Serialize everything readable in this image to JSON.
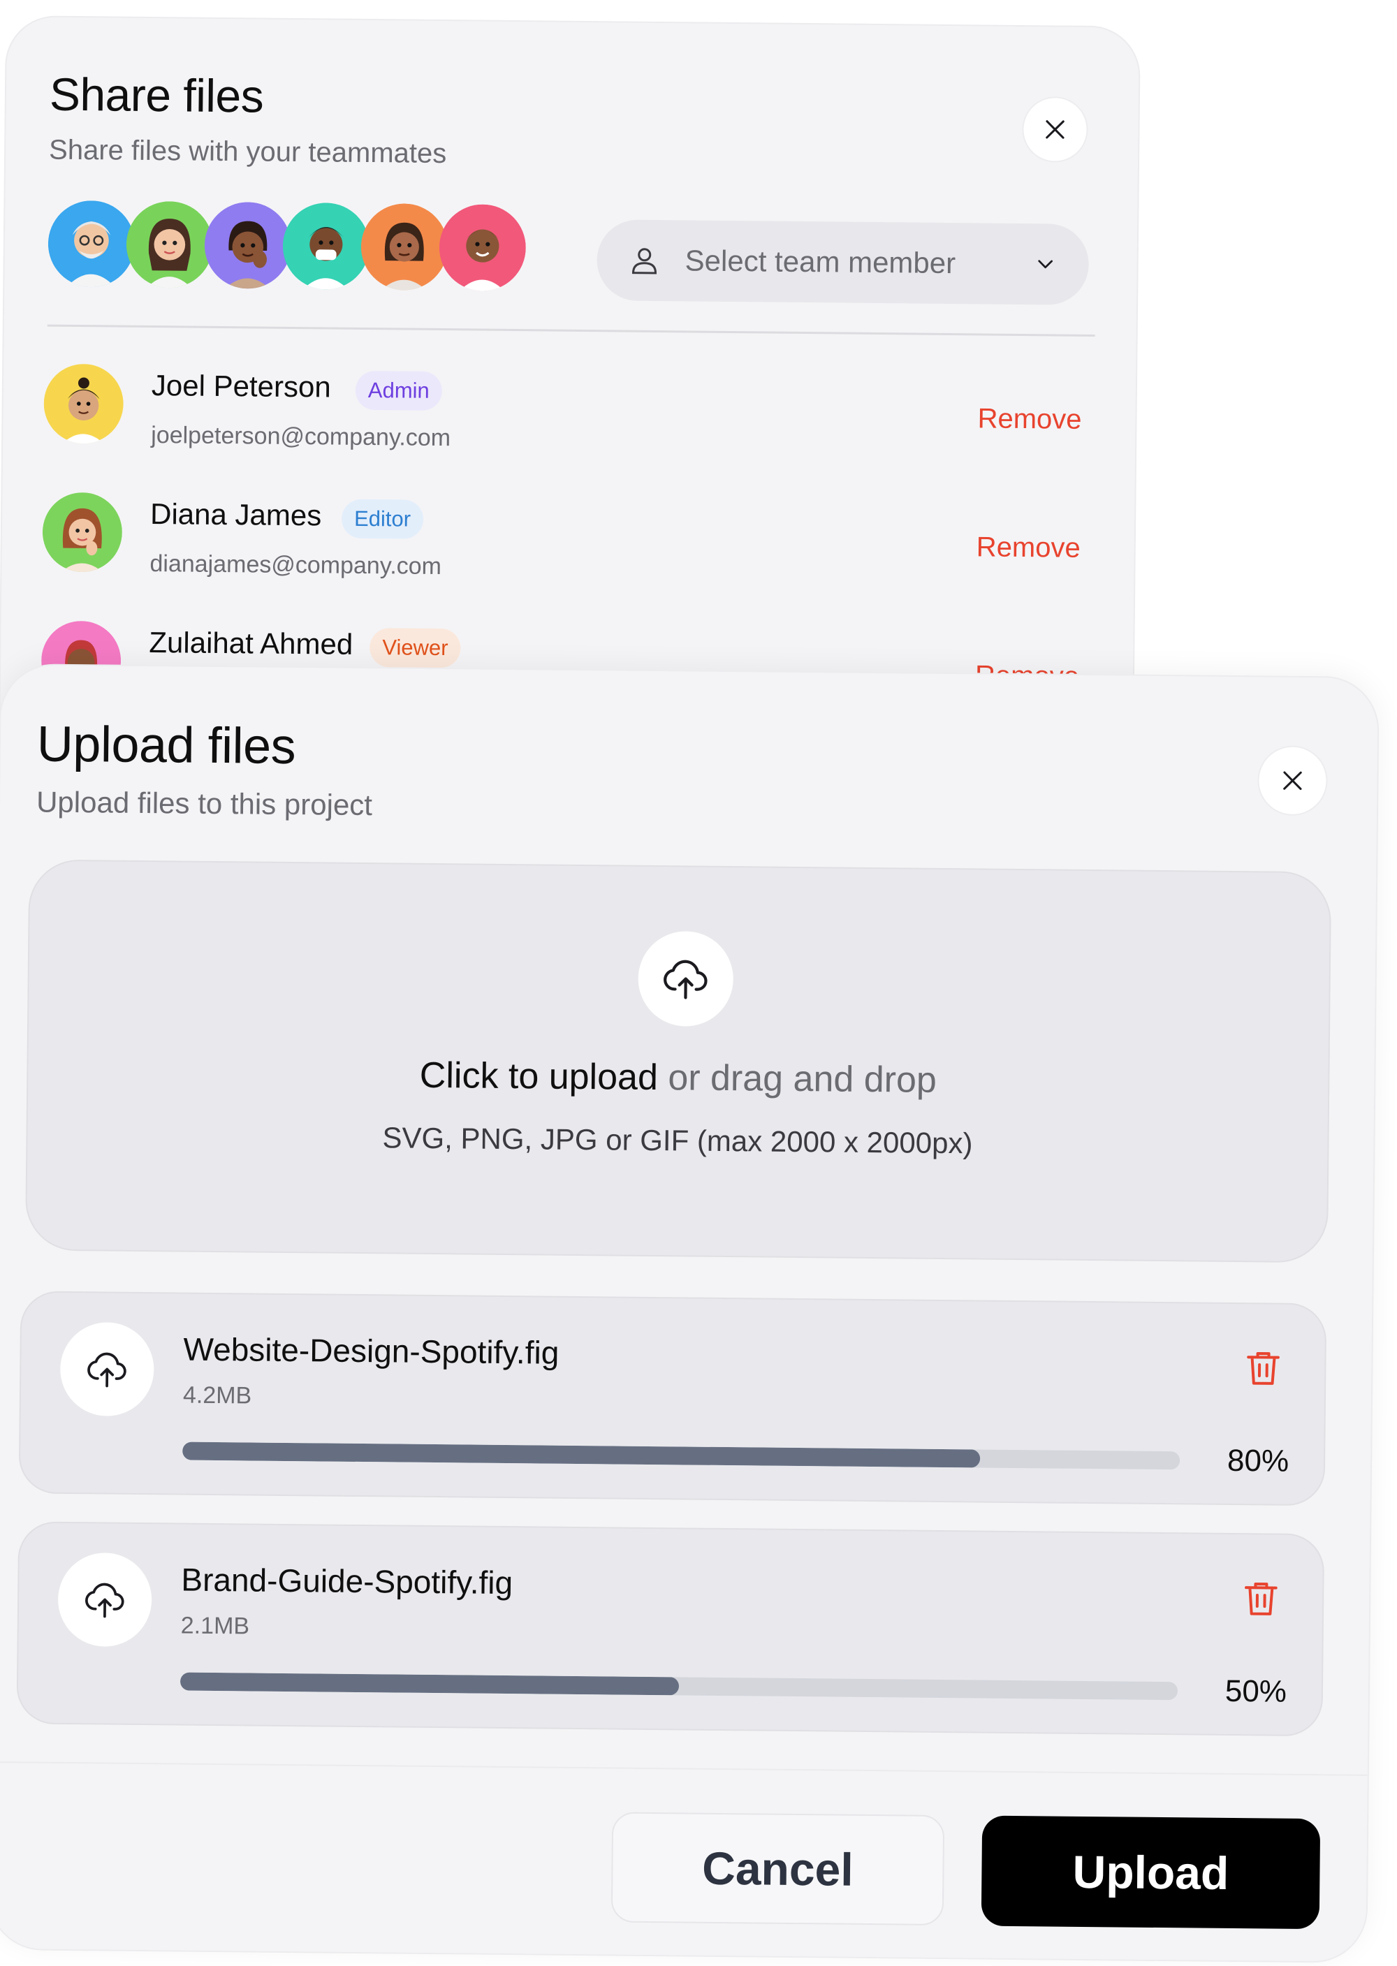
{
  "share": {
    "title": "Share files",
    "subtitle": "Share files with your teammates",
    "avatars": [
      {
        "bg": "#3aa7ef"
      },
      {
        "bg": "#79d35a"
      },
      {
        "bg": "#8f7cf0"
      },
      {
        "bg": "#35d2b4"
      },
      {
        "bg": "#f48a4a"
      },
      {
        "bg": "#f2587a"
      }
    ],
    "select_placeholder": "Select team member",
    "members": [
      {
        "name": "Joel Peterson",
        "role": "Admin",
        "email": "joelpeterson@company.com",
        "remove": "Remove",
        "avatar_bg": "#f7d64e"
      },
      {
        "name": "Diana James",
        "role": "Editor",
        "email": "dianajames@company.com",
        "remove": "Remove",
        "avatar_bg": "#7dd45c"
      },
      {
        "name": "Zulaihat Ahmed",
        "role": "Viewer",
        "email": "",
        "remove": "Remove",
        "avatar_bg": "#f47ac4"
      }
    ]
  },
  "upload": {
    "title": "Upload files",
    "subtitle": "Upload files to this project",
    "drop_strong": "Click to upload",
    "drop_weak": " or drag and drop",
    "drop_hint": "SVG, PNG, JPG or GIF (max 2000 x 2000px)",
    "files": [
      {
        "name": "Website-Design-Spotify.fig",
        "size": "4.2MB",
        "progress": 80,
        "progress_label": "80%"
      },
      {
        "name": "Brand-Guide-Spotify.fig",
        "size": "2.1MB",
        "progress": 50,
        "progress_label": "50%"
      }
    ],
    "cancel_label": "Cancel",
    "upload_label": "Upload"
  },
  "colors": {
    "remove": "#e8432e",
    "progress_fill": "#666f82",
    "progress_track": "#d4d6dc",
    "delete_icon": "#e8432e"
  },
  "icons": [
    "close-icon",
    "user-icon",
    "chevron-down-icon",
    "cloud-upload-icon",
    "trash-icon"
  ]
}
